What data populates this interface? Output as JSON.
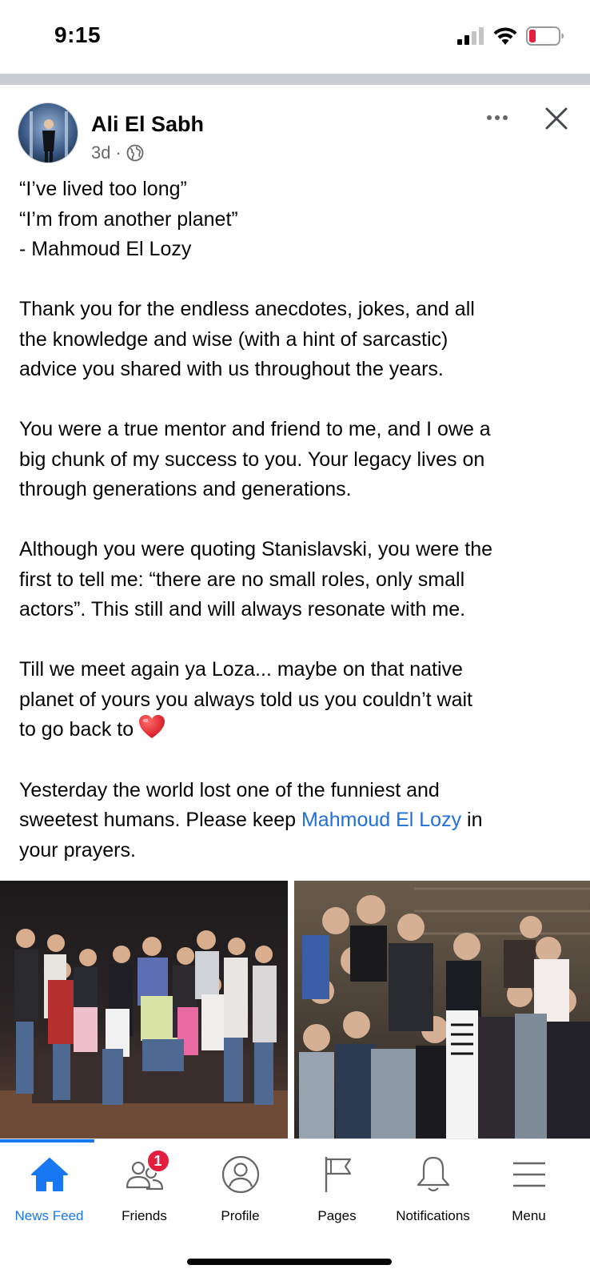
{
  "status_bar": {
    "time": "9:15",
    "battery_color": "#e41e3f"
  },
  "post": {
    "author": "Ali El Sabh",
    "age": "3d",
    "separator": "·",
    "privacy_icon": "globe-icon",
    "paragraphs": [
      [
        "“I’ve lived too long”",
        "“I’m from another planet”",
        "- Mahmoud El Lozy"
      ],
      [
        "Thank you for the endless anecdotes, jokes, and all",
        "the knowledge and wise (with a hint of sarcastic)",
        "advice you shared with us throughout the years."
      ],
      [
        "You were a true mentor and friend to me, and I owe a",
        "big chunk of my success to you. Your legacy lives on",
        "through generations and generations."
      ],
      [
        "Although you were quoting Stanislavski, you were the",
        "first to tell me: “there are no small roles, only small",
        "actors”. This still and will always resonate with me."
      ],
      [
        "Till we meet again ya Loza... maybe on that native",
        "planet of yours you always told us you couldn’t wait"
      ],
      [
        "Yesterday the world lost one of the funniest and"
      ]
    ],
    "heart_line": "to go back to",
    "last_line_prefix": "sweetest humans. Please keep ",
    "mention": "Mahmoud El Lozy",
    "last_line_suffix": " in",
    "final_line": "your prayers."
  },
  "tabs": [
    {
      "label": "News Feed",
      "icon": "home-icon",
      "active": true
    },
    {
      "label": "Friends",
      "icon": "friends-icon",
      "badge": "1"
    },
    {
      "label": "Profile",
      "icon": "profile-icon"
    },
    {
      "label": "Pages",
      "icon": "flag-icon"
    },
    {
      "label": "Notifications",
      "icon": "bell-icon"
    },
    {
      "label": "Menu",
      "icon": "menu-icon"
    }
  ],
  "colors": {
    "accent": "#1877f2",
    "link": "#216fdb",
    "badge": "#e41e3f",
    "secondary_text": "#65676b"
  }
}
